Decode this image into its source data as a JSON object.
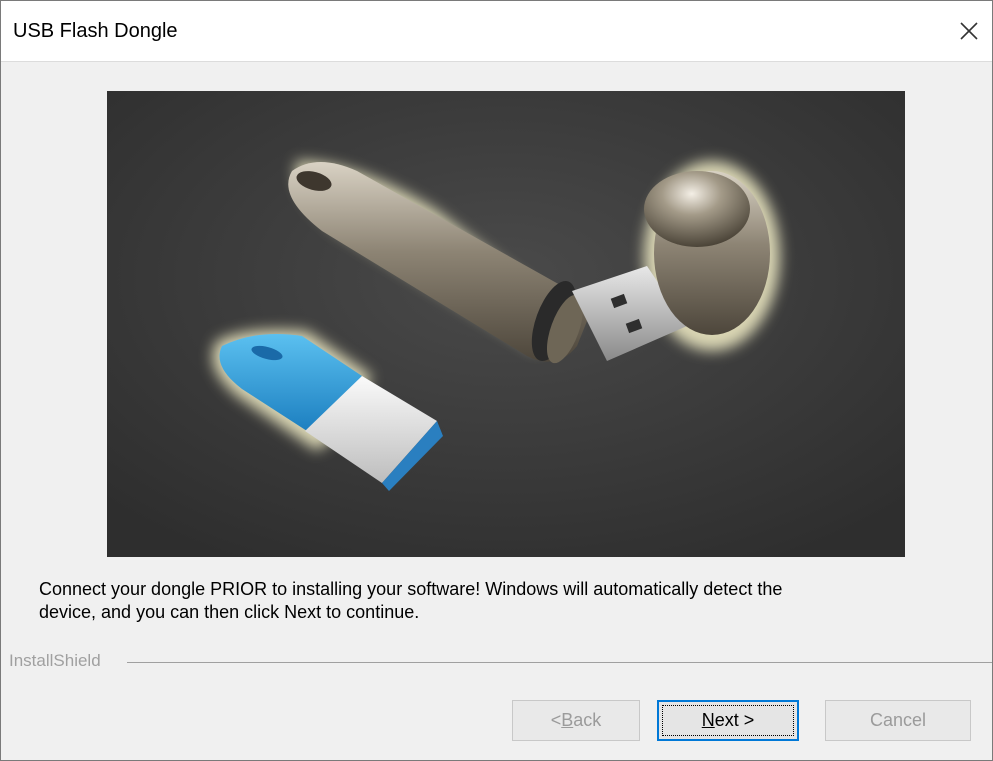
{
  "window": {
    "title": "USB Flash Dongle",
    "close_icon": "close-icon"
  },
  "hero": {
    "icon": "usb-dongle-photo"
  },
  "message": {
    "line1": "Connect your dongle PRIOR to installing your software!  Windows will automatically detect the",
    "line2": "device, and you can then click Next to continue."
  },
  "footer": {
    "group_label": "InstallShield"
  },
  "buttons": {
    "back_prefix": "< ",
    "back_accel": "B",
    "back_rest": "ack",
    "next_accel": "N",
    "next_rest": "ext >",
    "cancel": "Cancel"
  },
  "colors": {
    "accent": "#0078d7",
    "hero_background": "#3a3a3a",
    "dongle_blue": "#3aa0dc"
  }
}
